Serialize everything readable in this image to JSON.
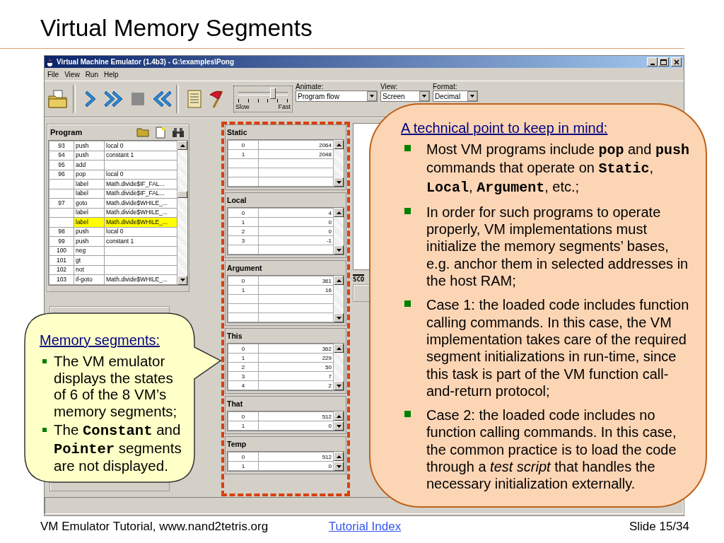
{
  "slide_title": "Virtual Memory Segments",
  "window": {
    "title": "Virtual Machine Emulator (1.4b3) - G:\\examples\\Pong",
    "menu": [
      "File",
      "View",
      "Run",
      "Help"
    ],
    "toolbar": {
      "speed_slider": {
        "level": 0.7,
        "min_label": "Slow",
        "max_label": "Fast"
      },
      "animate": {
        "label": "Animate:",
        "value": "Program flow"
      },
      "view": {
        "label": "View:",
        "value": "Screen"
      },
      "format": {
        "label": "Format:",
        "value": "Decimal"
      }
    },
    "program": {
      "title": "Program",
      "rows": [
        {
          "number": "93",
          "command": "push",
          "argument": "local 0",
          "selected": false
        },
        {
          "number": "94",
          "command": "push",
          "argument": "constant 1",
          "selected": false
        },
        {
          "number": "95",
          "command": "add",
          "argument": "",
          "selected": false
        },
        {
          "number": "96",
          "command": "pop",
          "argument": "local 0",
          "selected": false
        },
        {
          "number": "",
          "command": "label",
          "argument": "Math.divide$IF_FAL...",
          "selected": false
        },
        {
          "number": "",
          "command": "label",
          "argument": "Math.divide$IF_FAL...",
          "selected": false
        },
        {
          "number": "97",
          "command": "goto",
          "argument": "Math.divide$WHILE_...",
          "selected": false
        },
        {
          "number": "",
          "command": "label",
          "argument": "Math.divide$WHILE_...",
          "selected": false
        },
        {
          "number": "",
          "command": "label",
          "argument": "Math.divide$WHILE_...",
          "selected": true
        },
        {
          "number": "98",
          "command": "push",
          "argument": "local 0",
          "selected": false
        },
        {
          "number": "99",
          "command": "push",
          "argument": "constant 1",
          "selected": false
        },
        {
          "number": "100",
          "command": "neg",
          "argument": "",
          "selected": false
        },
        {
          "number": "101",
          "command": "gt",
          "argument": "",
          "selected": false
        },
        {
          "number": "102",
          "command": "not",
          "argument": "",
          "selected": false
        },
        {
          "number": "103",
          "command": "if-goto",
          "argument": "Math.divide$WHILE_...",
          "selected": false
        }
      ]
    },
    "segments": [
      {
        "name": "Static",
        "kind": "large",
        "rows": [
          {
            "index": "0",
            "value": "2064"
          },
          {
            "index": "1",
            "value": "2048"
          }
        ]
      },
      {
        "name": "Local",
        "kind": "large",
        "rows": [
          {
            "index": "0",
            "value": "4"
          },
          {
            "index": "1",
            "value": "0"
          },
          {
            "index": "2",
            "value": "0"
          },
          {
            "index": "3",
            "value": "-1"
          }
        ]
      },
      {
        "name": "Argument",
        "kind": "large",
        "rows": [
          {
            "index": "0",
            "value": "361"
          },
          {
            "index": "1",
            "value": "16"
          }
        ]
      },
      {
        "name": "This",
        "kind": "large",
        "rows": [
          {
            "index": "0",
            "value": "362"
          },
          {
            "index": "1",
            "value": "229"
          },
          {
            "index": "2",
            "value": "50"
          },
          {
            "index": "3",
            "value": "7"
          },
          {
            "index": "4",
            "value": "2"
          }
        ]
      },
      {
        "name": "That",
        "kind": "small",
        "rows": [
          {
            "index": "0",
            "value": "512"
          },
          {
            "index": "1",
            "value": "0"
          }
        ]
      },
      {
        "name": "Temp",
        "kind": "small",
        "rows": [
          {
            "index": "0",
            "value": "512"
          },
          {
            "index": "1",
            "value": "0"
          }
        ]
      }
    ],
    "screen_label": "SCO"
  },
  "memory_callout": {
    "heading": "Memory segments:",
    "bullets": [
      "The VM emulator displays the states of 6 of the 8 VM’s memory segments;",
      "The **Constant** and **Pointer** segments are not displayed."
    ]
  },
  "technical_callout": {
    "heading": "A technical point to keep in mind:",
    "bullets": [
      "Most VM programs include **pop** and **push** commands that operate on **Static**, **Local**, **Argument**, etc.;",
      "In order for such programs to operate properly, VM implementations must initialize the memory segments’ bases, e.g. anchor them in selected addresses in the host RAM;",
      "Case 1: the loaded code includes function calling commands.  In this case, the VM implementation takes care of the required segment initializations in run-time, since this task is part of the VM function call-and-return protocol;",
      "Case 2: the loaded code includes no function calling commands. In this case, the common practice is to load the code through a *test script* that handles the necessary initialization externally."
    ]
  },
  "footer": {
    "left": "VM Emulator Tutorial, www.nand2tetris.org",
    "link": "Tutorial Index",
    "page": "Slide 15/34"
  }
}
